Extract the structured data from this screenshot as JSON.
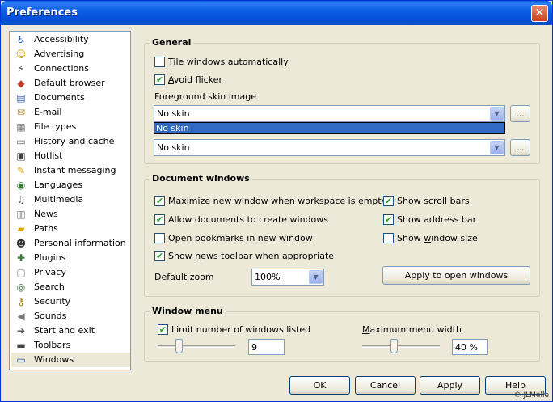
{
  "window": {
    "title": "Preferences",
    "close_glyph": "✕"
  },
  "sidebar": {
    "items": [
      {
        "label": "Accessibility",
        "icon": "accessibility-icon",
        "glyph": "♿",
        "color": "#1c4fa8"
      },
      {
        "label": "Advertising",
        "icon": "smiley-icon",
        "glyph": "☺",
        "color": "#d4a800"
      },
      {
        "label": "Connections",
        "icon": "plug-icon",
        "glyph": "⚡",
        "color": "#555"
      },
      {
        "label": "Default browser",
        "icon": "browser-icon",
        "glyph": "◆",
        "color": "#c0392b"
      },
      {
        "label": "Documents",
        "icon": "documents-icon",
        "glyph": "▤",
        "color": "#3b5ea8"
      },
      {
        "label": "E-mail",
        "icon": "envelope-icon",
        "glyph": "✉",
        "color": "#b08a30"
      },
      {
        "label": "File types",
        "icon": "file-types-icon",
        "glyph": "▦",
        "color": "#777"
      },
      {
        "label": "History and cache",
        "icon": "cache-icon",
        "glyph": "▭",
        "color": "#666"
      },
      {
        "label": "Hotlist",
        "icon": "hotlist-icon",
        "glyph": "▣",
        "color": "#444"
      },
      {
        "label": "Instant messaging",
        "icon": "messaging-icon",
        "glyph": "✎",
        "color": "#d4a800"
      },
      {
        "label": "Languages",
        "icon": "languages-icon",
        "glyph": "◉",
        "color": "#3b7a3b"
      },
      {
        "label": "Multimedia",
        "icon": "multimedia-icon",
        "glyph": "♫",
        "color": "#555"
      },
      {
        "label": "News",
        "icon": "news-icon",
        "glyph": "▥",
        "color": "#777"
      },
      {
        "label": "Paths",
        "icon": "folder-icon",
        "glyph": "▰",
        "color": "#d4a800"
      },
      {
        "label": "Personal information",
        "icon": "person-icon",
        "glyph": "☻",
        "color": "#333"
      },
      {
        "label": "Plugins",
        "icon": "plugins-icon",
        "glyph": "✚",
        "color": "#3b7a3b"
      },
      {
        "label": "Privacy",
        "icon": "privacy-icon",
        "glyph": "▢",
        "color": "#888"
      },
      {
        "label": "Search",
        "icon": "search-icon",
        "glyph": "◎",
        "color": "#2a6a2a"
      },
      {
        "label": "Security",
        "icon": "security-icon",
        "glyph": "⚷",
        "color": "#a07a00"
      },
      {
        "label": "Sounds",
        "icon": "sounds-icon",
        "glyph": "◀",
        "color": "#777"
      },
      {
        "label": "Start and exit",
        "icon": "start-exit-icon",
        "glyph": "➔",
        "color": "#444"
      },
      {
        "label": "Toolbars",
        "icon": "toolbars-icon",
        "glyph": "▬",
        "color": "#444"
      },
      {
        "label": "Windows",
        "icon": "windows-icon",
        "glyph": "▭",
        "color": "#1c4fa8"
      }
    ]
  },
  "general": {
    "title": "General",
    "tile_windows": {
      "label_u": "T",
      "label_rest": "ile windows automatically",
      "checked": false
    },
    "avoid_flicker": {
      "label_u": "A",
      "label_rest": "void flicker",
      "checked": true
    },
    "fg_skin_label": "Foreground skin image",
    "fg_skin_value": "No skin",
    "dropdown_option": "No skin",
    "bg_skin_value": "No skin",
    "browse_label": "..."
  },
  "document_windows": {
    "title": "Document windows",
    "maximize": {
      "label_u": "M",
      "label_rest": "aximize new window when workspace is empty",
      "checked": true
    },
    "allow_docs": {
      "label": "Allow documents to create windows",
      "checked": true
    },
    "open_bookmarks": {
      "label": "Open bookmarks in new window",
      "checked": false
    },
    "show_news": {
      "label_pre": "Show ",
      "label_u": "n",
      "label_rest": "ews toolbar when appropriate",
      "checked": true
    },
    "show_scroll": {
      "label_pre": "Show ",
      "label_u": "s",
      "label_rest": "croll bars",
      "checked": true
    },
    "show_address": {
      "label": "Show address bar",
      "checked": true
    },
    "show_window_size": {
      "label_pre": "Show ",
      "label_u": "w",
      "label_rest": "indow size",
      "checked": false
    },
    "default_zoom_label": "Default zoom",
    "default_zoom_value": "100%",
    "apply_open_label": "Apply to open windows"
  },
  "window_menu": {
    "title": "Window menu",
    "limit": {
      "label": "Limit number of windows listed",
      "checked": true
    },
    "limit_value": "9",
    "limit_level": 0.25,
    "max_width_label_u": "M",
    "max_width_label_rest": "aximum menu width",
    "max_width_value": "40 %",
    "max_width_level": 0.4
  },
  "buttons": {
    "ok": "OK",
    "cancel": "Cancel",
    "apply": "Apply",
    "help": "Help"
  },
  "copyright": "© JLMelle",
  "check_glyph": "✔",
  "arrow_glyph": "▼"
}
